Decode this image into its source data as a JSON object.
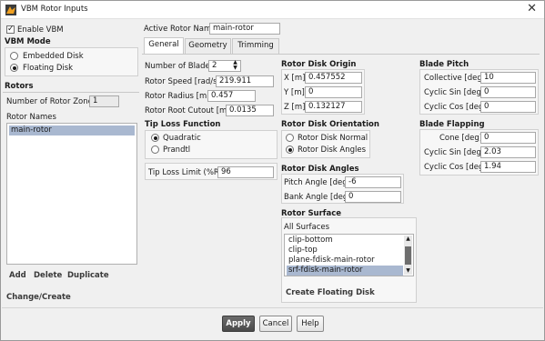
{
  "window": {
    "title": "VBM Rotor Inputs",
    "close_glyph": "✕",
    "app_icon": "fluent-app-icon"
  },
  "enable_vbm": {
    "label": "Enable VBM",
    "checked": true
  },
  "vbm_mode": {
    "header": "VBM Mode",
    "options": [
      "Embedded Disk",
      "Floating Disk"
    ],
    "selected": "Floating Disk"
  },
  "rotors": {
    "header": "Rotors",
    "count_label": "Number of Rotor Zones",
    "count_value": "1",
    "names_label": "Rotor Names",
    "names": [
      "main-rotor"
    ],
    "selected": "main-rotor",
    "actions": [
      "Add",
      "Delete",
      "Duplicate"
    ],
    "change_create": "Change/Create"
  },
  "active_rotor": {
    "label": "Active Rotor Name",
    "value": "main-rotor"
  },
  "tabs": [
    {
      "label": "General",
      "active": true
    },
    {
      "label": "Geometry",
      "active": false
    },
    {
      "label": "Trimming",
      "active": false
    }
  ],
  "general": {
    "num_blades": {
      "label": "Number of Blades",
      "value": "2"
    },
    "rotor_speed": {
      "label": "Rotor Speed [rad/s]",
      "value": "219.911"
    },
    "rotor_radius": {
      "label": "Rotor Radius [m]",
      "value": "0.457"
    },
    "root_cutout": {
      "label": "Rotor Root Cutout [m]",
      "value": "0.0135"
    },
    "tip_loss": {
      "header": "Tip Loss Function",
      "options": [
        "Quadratic",
        "Prandtl"
      ],
      "selected": "Quadratic"
    },
    "tip_loss_limit": {
      "label": "Tip Loss Limit (%R)",
      "value": "96"
    }
  },
  "disk_origin": {
    "header": "Rotor Disk Origin",
    "x": {
      "label": "X [m]",
      "value": "0.457552"
    },
    "y": {
      "label": "Y [m]",
      "value": "0"
    },
    "z": {
      "label": "Z [m]",
      "value": "0.132127"
    }
  },
  "disk_orientation": {
    "header": "Rotor Disk Orientation",
    "options": [
      "Rotor Disk Normal",
      "Rotor Disk Angles"
    ],
    "selected": "Rotor Disk Angles"
  },
  "disk_angles": {
    "header": "Rotor Disk Angles",
    "pitch": {
      "label": "Pitch Angle [deg]",
      "value": "-6"
    },
    "bank": {
      "label": "Bank Angle [deg]",
      "value": "0"
    }
  },
  "surface": {
    "header": "Rotor Surface",
    "all_label": "All Surfaces",
    "items": [
      "clip-bottom",
      "clip-top",
      "plane-fdisk-main-rotor",
      "srf-fdisk-main-rotor"
    ],
    "selected": "srf-fdisk-main-rotor",
    "create_label": "Create Floating Disk"
  },
  "blade_pitch": {
    "header": "Blade Pitch",
    "collective": {
      "label": "Collective [deg]",
      "value": "10"
    },
    "cyclic_sin": {
      "label": "Cyclic Sin [deg]",
      "value": "0"
    },
    "cyclic_cos": {
      "label": "Cyclic Cos [deg]",
      "value": "0"
    }
  },
  "blade_flapping": {
    "header": "Blade Flapping",
    "cone": {
      "label": "Cone [deg]",
      "value": "0"
    },
    "cyclic_sin": {
      "label": "Cyclic Sin [deg]",
      "value": "2.03"
    },
    "cyclic_cos": {
      "label": "Cyclic Cos [deg]",
      "value": "1.94"
    }
  },
  "footer": {
    "apply": "Apply",
    "cancel": "Cancel",
    "help": "Help"
  }
}
